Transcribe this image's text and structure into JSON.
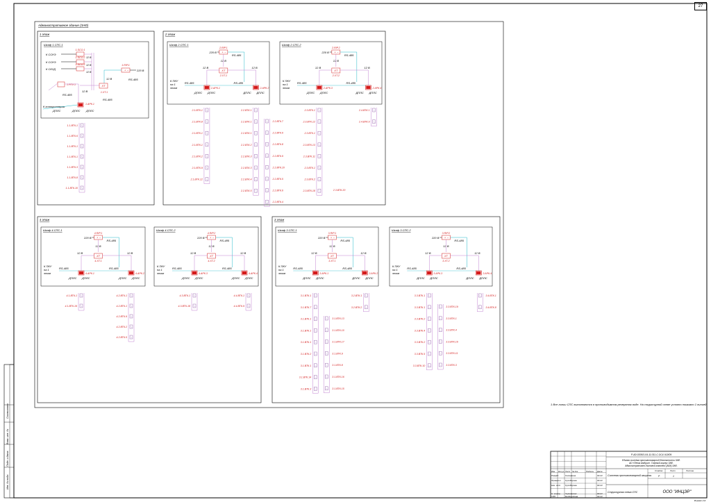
{
  "sheet_number": "27",
  "outer_frame_title": "Административное здание (ЗАФ)",
  "footnote": "1 Все линии СПС выполняются в противодымном резервном виде. На структурной схеме условно показано 1 линией.",
  "floors": {
    "f1": {
      "title": "1 этаж",
      "cab": "Шкаф 1.СПС.1"
    },
    "f2": {
      "title": "2 этаж",
      "cab1": "Шкаф 2.СПС.1",
      "cab2": "Шкаф 2.СПС.2"
    },
    "f4": {
      "title": "4 этаж",
      "cab1": "Шкаф 4.СПС.1",
      "cab2": "Шкаф 4.СПС.2"
    },
    "f3": {
      "title": "3 этаж",
      "cab1": "Шкаф 3.СПС.1",
      "cab2": "Шкаф 3.СПС.2"
    }
  },
  "labels": {
    "v220": "220 В",
    "v12": "12 В",
    "rs485": "RS-485",
    "dpls": "ДПЛС",
    "xt": "XT",
    "pku": "К ПКУ",
    "na1": "на 1",
    "etazh": "этаж",
    "k_sou1": "К СОУЭ",
    "k_sou2": "К СОУЭ",
    "k_skud": "К СКУД",
    "k_controller": "К контроллерам"
  },
  "f1_devices": {
    "sco1": "1.SCO.1",
    "sco2": "1.SCO.2",
    "sco3": "1.SCO.3",
    "rip1": "1.RIP.1",
    "xt1": "1.XT.1",
    "rpu1": "1.РПУ.1",
    "ark1": "1.АРК.1",
    "chain": [
      "1.1.ВТК.1",
      "1.1.ВТК.6",
      "1.1.ВТК.1",
      "1.1.ВТК.1",
      "1.1.ВТК.3",
      "1.1.ВТК.8",
      "1.1.ВТК.10"
    ]
  },
  "f2_devices": {
    "rip1": "2.RIP.1",
    "rip2": "2.RIP.2",
    "xt1": "2.XT.1",
    "xt2": "2.XT.2",
    "ark1": "2.АРК.1",
    "ark2": "2.АРК.2",
    "ark3": "2.АРК.3",
    "ark4": "2.АРК.4",
    "c1": [
      "2.1.ВТК.1",
      "2.1.ВТК.8",
      "2.1.ВТК.1",
      "2.1.ВТК.1",
      "2.1.ВТК.2",
      "2.1.ВТК.9",
      "2.1.ВТК.12"
    ],
    "c2a": [
      "2.2.ВТК.1",
      "2.2.ВТК.1",
      "2.2.ВТК.1",
      "2.2.ВТК.2",
      "2.2.ВТК.3",
      "2.2.ВТК.3",
      "2.2.ВТК.4",
      "2.2.ВТК.5"
    ],
    "c2b": [
      "2.2.ВТК.7",
      "2.2.ВТК.6",
      "2.2.ВТК.8",
      "2.2.ВТК.9",
      "2.2.ВТК.10",
      "2.2.ВТК.5",
      "2.2.ВТК.6",
      "2.2.ВТК.4"
    ],
    "c3": [
      "2.3.ВТК.1",
      "2.3.ВТК.12",
      "2.3.ВТК.1",
      "2.3.ВТК.13",
      "2.3.ВТК.11",
      "2.3.ВТК.1",
      "2.3.ВТК.2",
      "2.3.ВТК.18"
    ],
    "c3b": "2.3.ВТК.20",
    "c4": [
      "2.4.ВТК.1",
      "2.4.ВТК.9"
    ]
  },
  "f4_devices": {
    "rip1": "4.RIP.1",
    "rip2": "4.RIP.2",
    "xt1": "4.XT.1",
    "xt2": "4.XT.2",
    "ark1": "4.АРК.1",
    "ark2": "4.АРК.2",
    "ark3": "4.АРК.3",
    "ark4": "4.АРК.4",
    "c1": [
      "4.1.ВТК.1",
      "4.1.ВТК.19"
    ],
    "c2": [
      "4.2.ВТК.1",
      "4.2.ВТК.1",
      "4.2.ВТК.9",
      "4.2.ВТК.2",
      "4.2.ВТК.5"
    ],
    "c3": [
      "4.3.ВТК.1",
      "4.3.ВТК.18"
    ],
    "c4": [
      "4.4.ВТК.1",
      "4.4.ВТК.9"
    ]
  },
  "f3_devices": {
    "rip1": "3.RIP.1",
    "rip2": "3.RIP.2",
    "xt1": "3.XT.1",
    "xt2": "3.XT.2",
    "ark1": "3.АРК.1",
    "ark2": "3.АРК.2",
    "ark3": "3.АРК.3",
    "ark4": "3.АРК.4",
    "c1a": [
      "3.1.ВТК.1",
      "3.1.ВТК.7",
      "3.1.ВТК.1",
      "3.1.ВТК.1",
      "3.1.ВТК.1",
      "3.1.ВТК.2",
      "3.1.ВТК.1",
      "3.1.ВТК.14",
      "3.1.ВТК.3"
    ],
    "c1b": [
      "3.1.ВТК.13",
      "3.1.ВТК.10",
      "3.1.ВТК.17",
      "3.1.ВТК.9",
      "3.1.ВТК.8",
      "3.1.ВТК.16",
      "3.1.ВТК.15"
    ],
    "c2": [
      "3.2.ВТК.1",
      "3.2.ВТК.2"
    ],
    "c3a": [
      "3.3.ВТК.1",
      "3.3.ВТК.1",
      "3.3.ВТК.2",
      "3.3.ВТК.4",
      "3.3.ВТК.2",
      "3.3.ВТК.5",
      "3.3.ВТК.10"
    ],
    "c3b": [
      "3.3.ВТК.19",
      "3.3.ВТК.1",
      "3.3.ВТК.4",
      "3.3.ВТК.16",
      "3.3.ВТК.11",
      "3.3.ВТК.3"
    ],
    "c4": [
      "3.4.ВТК.1",
      "3.4.ВТК.8"
    ]
  },
  "title_block": {
    "code": "Р-АЭ-0305/1-04-11.011-С.ОС4-ЧСК09",
    "desc1": "Единая система противопожарной безопасности ЗАФ.",
    "desc2": "АО «Пенза Амбрин». Главный корпус ЗАФ.",
    "desc3": "Административно-бытовой комплекс (АБК) ЗАФ.",
    "system": "Система противопожарной защиты",
    "sheet_title": "Структурная схема СПС",
    "company": "ООО \"ИНЦЭР\"",
    "stage_h": "Стадия",
    "sheet_h": "Лист",
    "sheets_h": "Листов",
    "stage": "Р",
    "sheet": "1",
    "format": "Формат А3",
    "hdr": [
      "Изм.",
      "Кол.уч",
      "Лист",
      "№ док.",
      "Подпись",
      "Дата"
    ],
    "roles": [
      "Разраб.",
      "Проверил",
      "Нач. отд.",
      "",
      "Н. контр.",
      "ГИП"
    ],
    "names": [
      "Селиванов",
      "Сухоборова",
      "Сухоборова",
      "",
      "Чернявская",
      "Безбородова"
    ],
    "dates": [
      "03.24",
      "03.24",
      "03.24",
      "",
      "03.24",
      "03.24"
    ]
  },
  "left_strip": [
    "Согласовано",
    "Взам. инв. №",
    "Подп. и дата",
    "Инв. № подл."
  ]
}
